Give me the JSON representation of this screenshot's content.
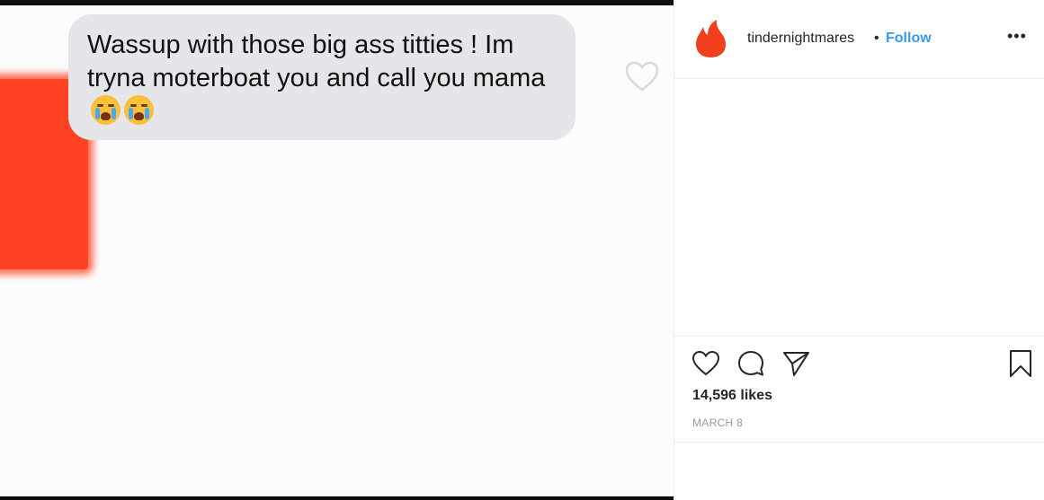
{
  "post": {
    "message": "Wassup with those big ass titties ! Im tryna moterboat you and call you mama",
    "emoji_icons": [
      "loudly-crying-face-icon",
      "loudly-crying-face-icon"
    ],
    "redaction_color": "#ff4221",
    "bubble_color": "#e6e5ea"
  },
  "header": {
    "username": "tindernightmares",
    "separator": "•",
    "follow_label": "Follow",
    "more_label": "•••",
    "avatar_icon": "tinder-flame-icon",
    "accent_color": "#3897f0"
  },
  "actions": {
    "icons": [
      "heart-icon",
      "comment-icon",
      "share-icon",
      "bookmark-icon"
    ],
    "likes": "14,596 likes",
    "date": "MARCH 8"
  }
}
